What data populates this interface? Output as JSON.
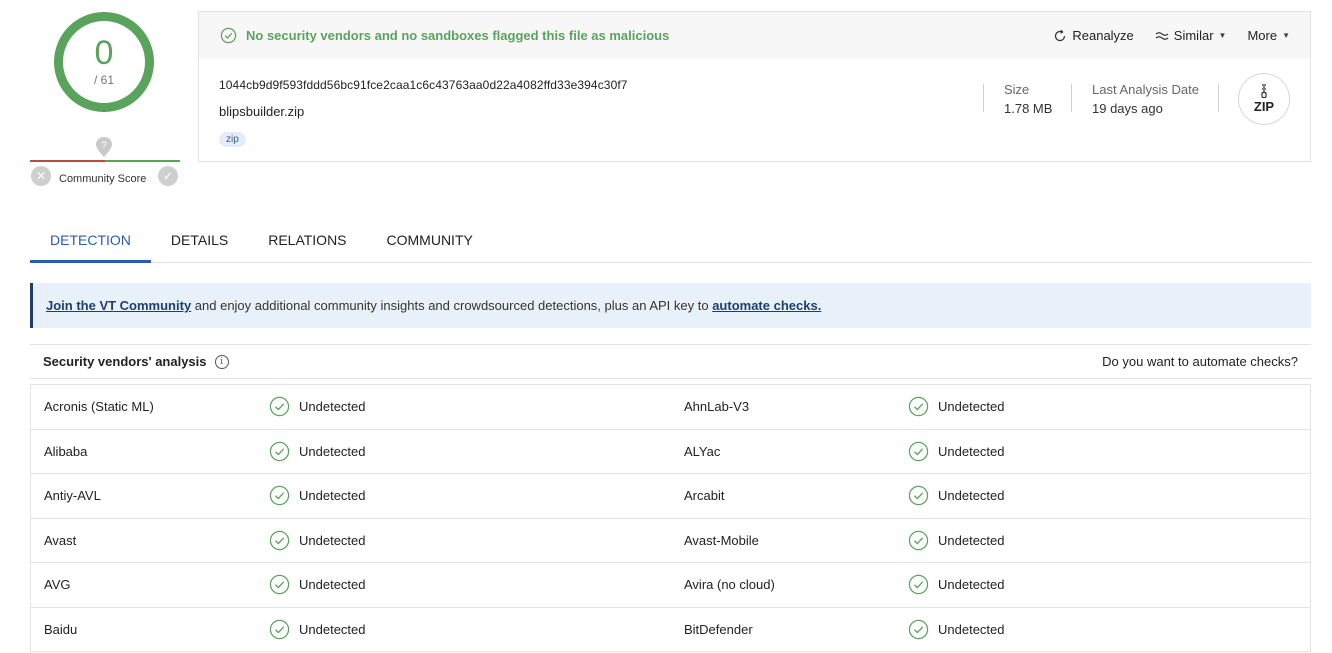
{
  "score": {
    "detections": "0",
    "total": "/ 61",
    "community_label": "Community Score",
    "marker": "?"
  },
  "summary": {
    "status_message": "No security vendors and no sandboxes flagged this file as malicious",
    "actions": {
      "reanalyze": "Reanalyze",
      "similar": "Similar",
      "more": "More"
    },
    "hash": "1044cb9d9f593fddd56bc91fce2caa1c6c43763aa0d22a4082ffd33e394c30f7",
    "filename": "blipsbuilder.zip",
    "tag": "zip",
    "size_label": "Size",
    "size_value": "1.78 MB",
    "date_label": "Last Analysis Date",
    "date_value": "19 days ago",
    "filetype_icon_label": "ZIP"
  },
  "tabs": [
    {
      "label": "DETECTION",
      "active": true
    },
    {
      "label": "DETAILS",
      "active": false
    },
    {
      "label": "RELATIONS",
      "active": false
    },
    {
      "label": "COMMUNITY",
      "active": false
    }
  ],
  "banner": {
    "link1": "Join the VT Community",
    "middle": " and enjoy additional community insights and crowdsourced detections, plus an API key to ",
    "link2": "automate checks."
  },
  "vendors_header": {
    "title": "Security vendors' analysis",
    "info": "i",
    "right": "Do you want to automate checks?"
  },
  "vendors": [
    {
      "left": {
        "name": "Acronis (Static ML)",
        "result": "Undetected"
      },
      "right": {
        "name": "AhnLab-V3",
        "result": "Undetected"
      }
    },
    {
      "left": {
        "name": "Alibaba",
        "result": "Undetected"
      },
      "right": {
        "name": "ALYac",
        "result": "Undetected"
      }
    },
    {
      "left": {
        "name": "Antiy-AVL",
        "result": "Undetected"
      },
      "right": {
        "name": "Arcabit",
        "result": "Undetected"
      }
    },
    {
      "left": {
        "name": "Avast",
        "result": "Undetected"
      },
      "right": {
        "name": "Avast-Mobile",
        "result": "Undetected"
      }
    },
    {
      "left": {
        "name": "AVG",
        "result": "Undetected"
      },
      "right": {
        "name": "Avira (no cloud)",
        "result": "Undetected"
      }
    },
    {
      "left": {
        "name": "Baidu",
        "result": "Undetected"
      },
      "right": {
        "name": "BitDefender",
        "result": "Undetected"
      }
    }
  ],
  "colors": {
    "clean": "#5aa35c",
    "accent": "#2a5db0",
    "banner_bg": "#e8f1fa",
    "malicious": "#b94b4b"
  }
}
